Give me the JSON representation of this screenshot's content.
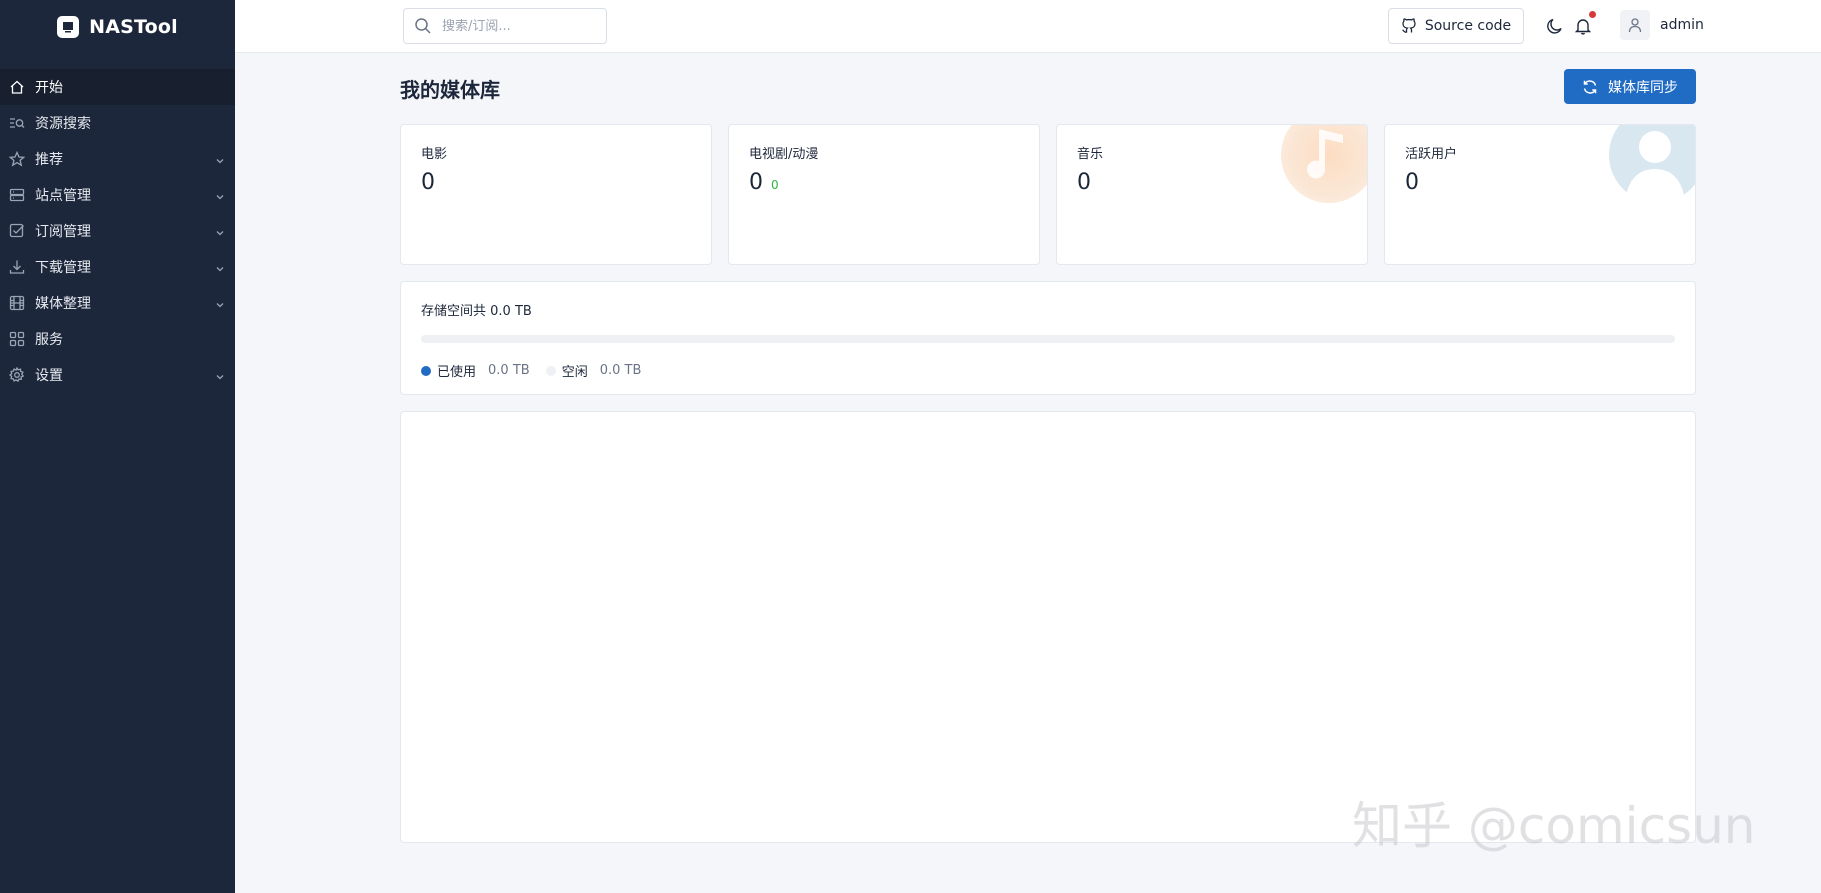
{
  "app": {
    "name": "NASTool"
  },
  "sidebar": {
    "items": [
      {
        "label": "开始",
        "icon": "home-icon",
        "expandable": false,
        "active": true
      },
      {
        "label": "资源搜索",
        "icon": "search-list-icon",
        "expandable": false,
        "active": false
      },
      {
        "label": "推荐",
        "icon": "star-icon",
        "expandable": true,
        "active": false
      },
      {
        "label": "站点管理",
        "icon": "server-icon",
        "expandable": true,
        "active": false
      },
      {
        "label": "订阅管理",
        "icon": "checkbox-icon",
        "expandable": true,
        "active": false
      },
      {
        "label": "下载管理",
        "icon": "download-icon",
        "expandable": true,
        "active": false
      },
      {
        "label": "媒体整理",
        "icon": "film-icon",
        "expandable": true,
        "active": false
      },
      {
        "label": "服务",
        "icon": "apps-icon",
        "expandable": false,
        "active": false
      },
      {
        "label": "设置",
        "icon": "gear-icon",
        "expandable": true,
        "active": false
      }
    ]
  },
  "header": {
    "search_placeholder": "搜索/订阅...",
    "source_code_label": "Source code",
    "username": "admin"
  },
  "main": {
    "title": "我的媒体库",
    "sync_button_label": "媒体库同步",
    "stats": [
      {
        "label": "电影",
        "value": "0",
        "sub": ""
      },
      {
        "label": "电视剧/动漫",
        "value": "0",
        "sub": "0"
      },
      {
        "label": "音乐",
        "value": "0",
        "sub": ""
      },
      {
        "label": "活跃用户",
        "value": "0",
        "sub": ""
      }
    ],
    "storage": {
      "title": "存储空间共 0.0 TB",
      "used_label": "已使用",
      "used_value": "0.0 TB",
      "free_label": "空闲",
      "free_value": "0.0 TB",
      "used_fraction": 0
    }
  },
  "watermark": "知乎 @comicsun",
  "colors": {
    "sidebar_bg": "#1d273b",
    "primary": "#206bc4",
    "success": "#2fb344",
    "notification": "#d63939"
  }
}
